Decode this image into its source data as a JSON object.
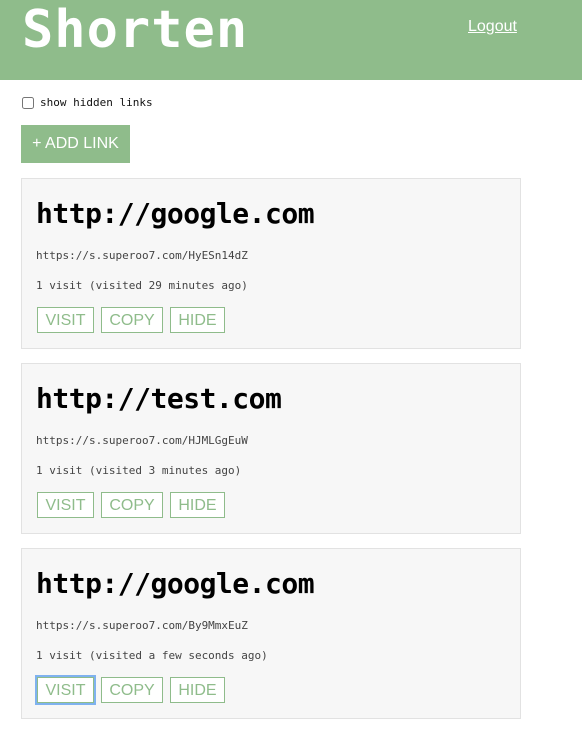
{
  "header": {
    "logo": "Shorten",
    "logout": "Logout"
  },
  "options": {
    "show_hidden_label": "show hidden links",
    "show_hidden_checked": false
  },
  "add_button": "+ ADD LINK",
  "links": [
    {
      "url": "http://google.com",
      "short_url": "https://s.superoo7.com/HyESn14dZ",
      "visits": "1 visit (visited 29 minutes ago)",
      "visit_label": "VISIT",
      "copy_label": "COPY",
      "hide_label": "HIDE"
    },
    {
      "url": "http://test.com",
      "short_url": "https://s.superoo7.com/HJMLGgEuW",
      "visits": "1 visit (visited 3 minutes ago)",
      "visit_label": "VISIT",
      "copy_label": "COPY",
      "hide_label": "HIDE"
    },
    {
      "url": "http://google.com",
      "short_url": "https://s.superoo7.com/By9MmxEuZ",
      "visits": "1 visit (visited a few seconds ago)",
      "visit_label": "VISIT",
      "copy_label": "COPY",
      "hide_label": "HIDE"
    }
  ],
  "colors": {
    "accent": "#8fbc8b",
    "card_bg": "#f7f7f7",
    "focus_ring": "#7fb2ef"
  }
}
